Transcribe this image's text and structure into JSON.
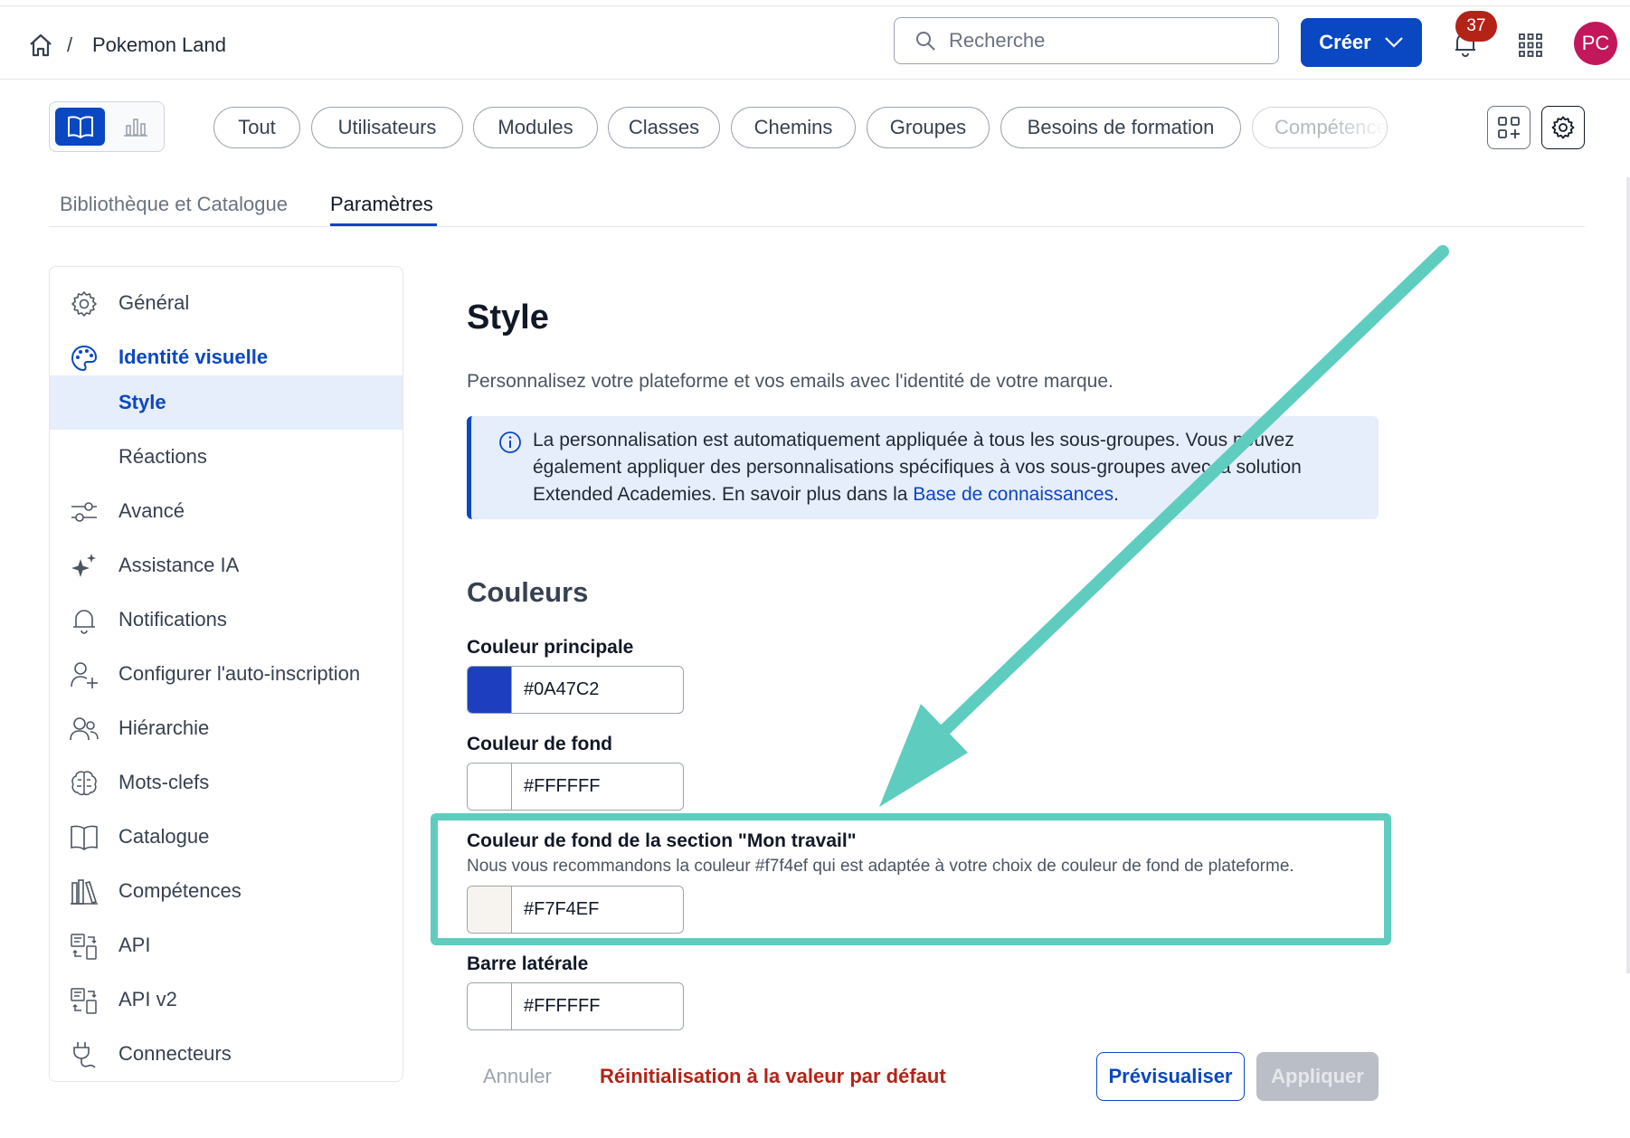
{
  "header": {
    "breadcrumb_sep": "/",
    "title": "Pokemon Land",
    "search_placeholder": "Recherche",
    "create_label": "Créer",
    "notifications_count": "37",
    "avatar_initials": "PC"
  },
  "filters": {
    "chips": [
      "Tout",
      "Utilisateurs",
      "Modules",
      "Classes",
      "Chemins",
      "Groupes",
      "Besoins de formation",
      "Compétences"
    ]
  },
  "tabs": {
    "library": "Bibliothèque et Catalogue",
    "settings": "Paramètres"
  },
  "sidebar": {
    "items": [
      {
        "label": "Général",
        "icon": "gear-icon"
      },
      {
        "label": "Identité visuelle",
        "icon": "palette-icon"
      },
      {
        "label": "Style",
        "icon": ""
      },
      {
        "label": "Réactions",
        "icon": ""
      },
      {
        "label": "Avancé",
        "icon": "sliders-icon"
      },
      {
        "label": "Assistance IA",
        "icon": "sparkle-icon"
      },
      {
        "label": "Notifications",
        "icon": "bell-icon"
      },
      {
        "label": "Configurer l'auto-inscription",
        "icon": "user-plus-icon"
      },
      {
        "label": "Hiérarchie",
        "icon": "users-icon"
      },
      {
        "label": "Mots-clefs",
        "icon": "brain-icon"
      },
      {
        "label": "Catalogue",
        "icon": "book-icon"
      },
      {
        "label": "Compétences",
        "icon": "books-icon"
      },
      {
        "label": "API",
        "icon": "api-icon"
      },
      {
        "label": "API v2",
        "icon": "api-icon"
      },
      {
        "label": "Connecteurs",
        "icon": "plug-icon"
      }
    ]
  },
  "main": {
    "title": "Style",
    "subtitle": "Personnalisez votre plateforme et vos emails avec l'identité de votre marque.",
    "info_text": "La personnalisation est automatiquement appliquée à tous les sous-groupes. Vous pouvez également appliquer des personnalisations spécifiques à vos sous-groupes avec la solution Extended Academies. En savoir plus dans la ",
    "info_link": "Base de connaissances",
    "info_end": ".",
    "colors_title": "Couleurs",
    "fields": {
      "primary": {
        "label": "Couleur principale",
        "value": "#0A47C2",
        "swatch": "#1d3fbf"
      },
      "background": {
        "label": "Couleur de fond",
        "value": "#FFFFFF",
        "swatch": "#ffffff"
      },
      "my_work": {
        "label": "Couleur de fond de la section \"Mon travail\"",
        "help": "Nous vous recommandons la couleur #f7f4ef qui est adaptée à votre choix de couleur de fond de plateforme.",
        "value": "#F7F4EF",
        "swatch": "#f7f4ef"
      },
      "sidebar": {
        "label": "Barre latérale",
        "value": "#FFFFFF",
        "swatch": "#ffffff"
      }
    },
    "actions": {
      "cancel": "Annuler",
      "reset": "Réinitialisation à la valeur par défaut",
      "preview": "Prévisualiser",
      "apply": "Appliquer"
    }
  },
  "colors": {
    "accent": "#0A47C2",
    "highlight": "#5ecdc0",
    "danger": "#b42318",
    "avatar": "#c2185b"
  }
}
